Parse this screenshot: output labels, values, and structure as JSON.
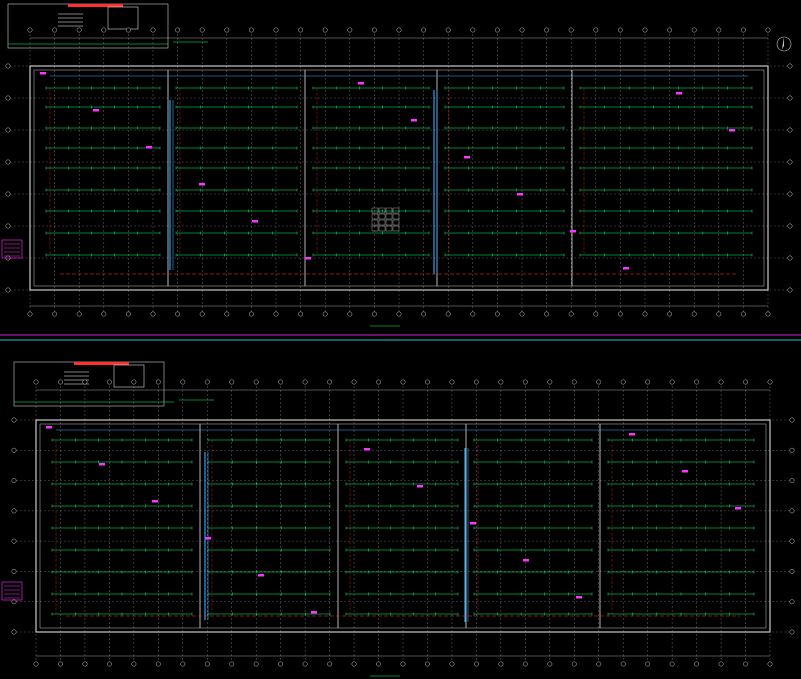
{
  "viewer": {
    "background": "#000000",
    "colors": {
      "outline": "#c8c8c8",
      "grid": "#9a9a9a",
      "branch": "#00ff66",
      "fixture": "#00ff66",
      "riser": "#ff3030",
      "main": "#33aaff",
      "magenta": "#ff33ff",
      "separator_magenta": "#d020d0",
      "separator_cyan": "#20c0d0",
      "white": "#ffffff"
    }
  },
  "plans": [
    {
      "id": "upper",
      "title": "",
      "north_arrow": true
    },
    {
      "id": "lower",
      "title": "",
      "north_arrow": false
    }
  ],
  "icons": [
    "north-arrow-icon",
    "sprinkler-icon"
  ]
}
